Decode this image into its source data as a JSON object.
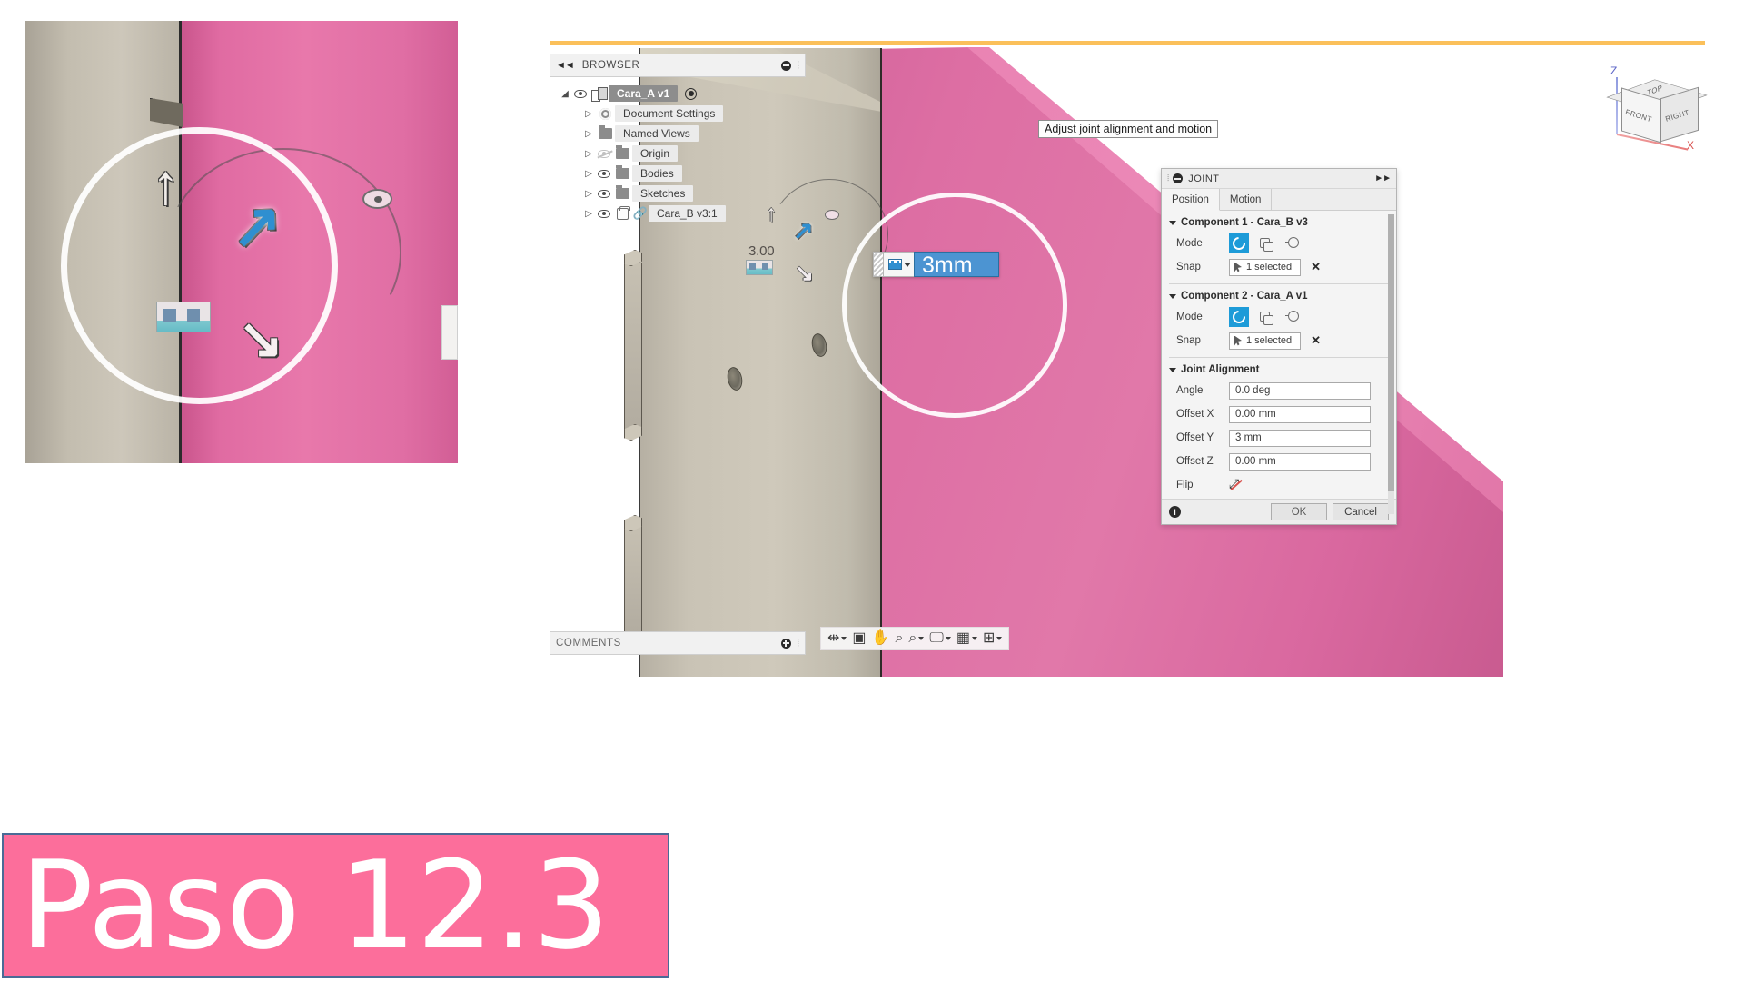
{
  "detail_callout": {
    "name": "magnified-joint-manipulator",
    "arrows": {
      "up": "↑",
      "northeast": "↗",
      "southeast": "↘"
    }
  },
  "browser": {
    "collapse_glyph": "◄◄",
    "title": "BROWSER",
    "tree": [
      {
        "label": "Cara_A v1",
        "icon": "component-icon",
        "selected": true,
        "eye": "visible",
        "twisty": "◢",
        "radio": true,
        "indent": 0
      },
      {
        "label": "Document Settings",
        "icon": "gear-icon",
        "selected": false,
        "eye": "none",
        "twisty": "▷",
        "radio": false,
        "indent": 1
      },
      {
        "label": "Named Views",
        "icon": "folder-icon",
        "selected": false,
        "eye": "none",
        "twisty": "▷",
        "radio": false,
        "indent": 1
      },
      {
        "label": "Origin",
        "icon": "folder-icon",
        "selected": false,
        "eye": "hidden",
        "twisty": "▷",
        "radio": false,
        "indent": 1
      },
      {
        "label": "Bodies",
        "icon": "folder-icon",
        "selected": false,
        "eye": "visible",
        "twisty": "▷",
        "radio": false,
        "indent": 1
      },
      {
        "label": "Sketches",
        "icon": "folder-icon",
        "selected": false,
        "eye": "visible",
        "twisty": "▷",
        "radio": false,
        "indent": 1
      },
      {
        "label": "Cara_B v3:1",
        "icon": "body-icon",
        "link": true,
        "selected": false,
        "eye": "visible",
        "twisty": "▷",
        "radio": false,
        "indent": 1
      }
    ]
  },
  "comments": {
    "title": "COMMENTS"
  },
  "nav_toolbar": {
    "items": [
      {
        "name": "orbit-icon",
        "glyph": "⇹",
        "caret": true
      },
      {
        "name": "look-at-icon",
        "glyph": "▣",
        "caret": false
      },
      {
        "name": "pan-icon",
        "glyph": "✋",
        "caret": false
      },
      {
        "name": "zoom-icon",
        "glyph": "⌕",
        "caret": false
      },
      {
        "name": "fit-icon",
        "glyph": "⌕",
        "caret": true
      },
      {
        "name": "display-settings-icon",
        "glyph": "🖵",
        "caret": true
      },
      {
        "name": "grid-snaps-icon",
        "glyph": "▦",
        "caret": true
      },
      {
        "name": "viewports-icon",
        "glyph": "⊞",
        "caret": true
      }
    ]
  },
  "viewport": {
    "tooltip": "Adjust joint alignment and motion",
    "dimension_label": "3.00",
    "inline_input": {
      "value": "3mm",
      "selected": true
    },
    "viewcube": {
      "faces": {
        "top": "TOP",
        "front": "FRONT",
        "right": "RIGHT"
      },
      "axes": {
        "z": "Z",
        "x": "X"
      }
    }
  },
  "joint_dialog": {
    "title": "JOINT",
    "expand_glyph": "►►",
    "tabs": [
      {
        "label": "Position",
        "active": true
      },
      {
        "label": "Motion",
        "active": false
      }
    ],
    "component1": {
      "heading": "Component 1 - Cara_B v3",
      "mode_label": "Mode",
      "mode_options": [
        "rigid-icon",
        "revolute-icon",
        "slider-icon"
      ],
      "mode_selected": 0,
      "snap_label": "Snap",
      "snap_value": "1 selected",
      "snap_clear": "✕"
    },
    "component2": {
      "heading": "Component 2 - Cara_A v1",
      "mode_label": "Mode",
      "mode_options": [
        "rigid-icon",
        "revolute-icon",
        "slider-icon"
      ],
      "mode_selected": 0,
      "snap_label": "Snap",
      "snap_value": "1 selected",
      "snap_clear": "✕"
    },
    "alignment": {
      "heading": "Joint Alignment",
      "fields": [
        {
          "label": "Angle",
          "value": "0.0 deg"
        },
        {
          "label": "Offset X",
          "value": "0.00 mm"
        },
        {
          "label": "Offset Y",
          "value": "3 mm"
        },
        {
          "label": "Offset Z",
          "value": "0.00 mm"
        }
      ],
      "flip_label": "Flip"
    },
    "footer": {
      "info_glyph": "i",
      "ok_label": "OK",
      "cancel_label": "Cancel"
    }
  },
  "title_block": {
    "text": "Paso 12.3",
    "background_color": "#fc6e9b",
    "border_color": "#4a6b96",
    "text_color": "#ffffff"
  }
}
